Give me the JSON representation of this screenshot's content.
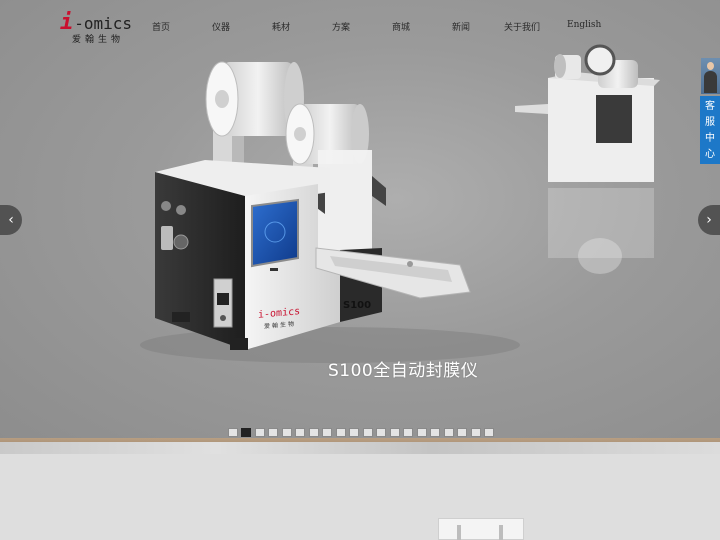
{
  "logo": {
    "i_letter": "i",
    "text": "-omics",
    "subtitle": "爱翰生物"
  },
  "nav": {
    "items": [
      {
        "label": "首页"
      },
      {
        "label": "仪器"
      },
      {
        "label": "耗材"
      },
      {
        "label": "方案"
      },
      {
        "label": "商城"
      },
      {
        "label": "新闻"
      },
      {
        "label": "关于我们"
      },
      {
        "label": "English"
      }
    ]
  },
  "slider": {
    "caption": "S100全自动封膜仪",
    "product_model_text": "S100",
    "product_logo_text": "i-omics",
    "product_logo_sub": "爱翰生物",
    "prev_icon": "chevron-left-icon",
    "next_icon": "chevron-right-icon",
    "prev_glyph": "‹",
    "next_glyph": "›",
    "dot_count": 20,
    "active_dot": 2
  },
  "customer_service": {
    "label": "客服中心"
  },
  "colors": {
    "brand_red": "#c8102e",
    "cs_blue": "#1d78c8",
    "hero_gray": "#9a9a9a"
  }
}
